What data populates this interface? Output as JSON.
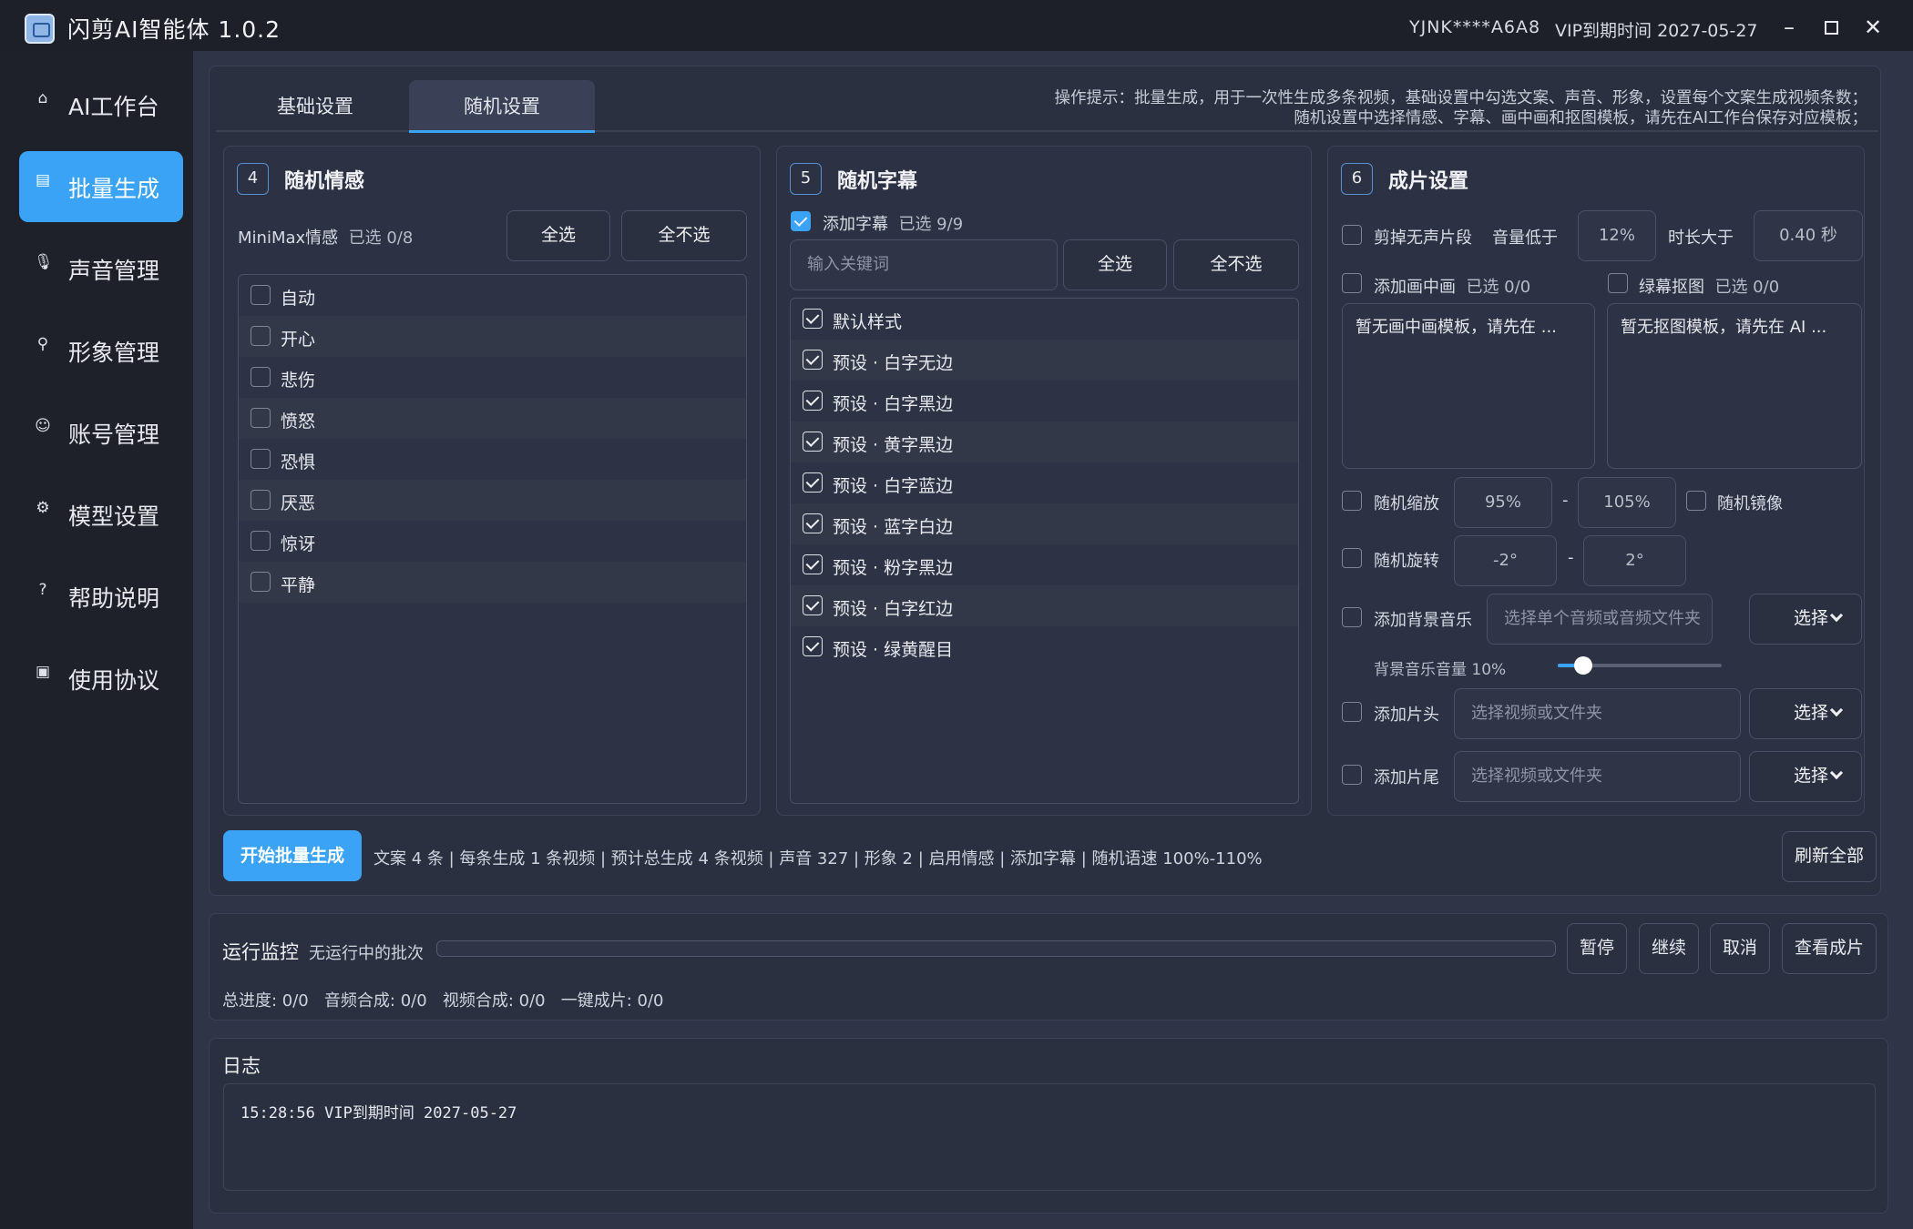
{
  "app": {
    "title": "闪剪AI智能体 1.0.2",
    "user_id": "YJNK****A6A8",
    "vip": "VIP到期时间 2027-05-27"
  },
  "window": {
    "minimize": "–",
    "close": "✕"
  },
  "sidebar": {
    "items": [
      {
        "label": "AI工作台",
        "icon": "home-icon",
        "glyph": "⌂"
      },
      {
        "label": "批量生成",
        "icon": "document-icon",
        "glyph": "▤"
      },
      {
        "label": "声音管理",
        "icon": "microphone-icon",
        "glyph": "🎙"
      },
      {
        "label": "形象管理",
        "icon": "user-icon",
        "glyph": "⚲"
      },
      {
        "label": "账号管理",
        "icon": "account-circle-icon",
        "glyph": "☺"
      },
      {
        "label": "模型设置",
        "icon": "gear-icon",
        "glyph": "⚙"
      },
      {
        "label": "帮助说明",
        "icon": "help-icon",
        "glyph": "?"
      },
      {
        "label": "使用协议",
        "icon": "agreement-icon",
        "glyph": "▣"
      }
    ],
    "active_index": 1
  },
  "tabs": [
    {
      "label": "基础设置"
    },
    {
      "label": "随机设置"
    }
  ],
  "hint": {
    "line1": "操作提示：批量生成，用于一次性生成多条视频，基础设置中勾选文案、声音、形象，设置每个文案生成视频条数；",
    "line2": "随机设置中选择情感、字幕、画中画和抠图模板，请先在AI工作台保存对应模板；"
  },
  "emotion": {
    "num": "4",
    "title": "随机情感",
    "source": "MiniMax情感",
    "selected": "已选 0/8",
    "select_all": "全选",
    "select_none": "全不选",
    "items": [
      "自动",
      "开心",
      "悲伤",
      "愤怒",
      "恐惧",
      "厌恶",
      "惊讶",
      "平静"
    ]
  },
  "subtitle": {
    "num": "5",
    "title": "随机字幕",
    "add_label": "添加字幕",
    "selected": "已选 9/9",
    "search_placeholder": "输入关键词",
    "select_all": "全选",
    "select_none": "全不选",
    "items": [
      "默认样式",
      "预设 · 白字无边",
      "预设 · 白字黑边",
      "预设 · 黄字黑边",
      "预设 · 白字蓝边",
      "预设 · 蓝字白边",
      "预设 · 粉字黑边",
      "预设 · 白字红边",
      "预设 · 绿黄醒目"
    ]
  },
  "output": {
    "num": "6",
    "title": "成片设置",
    "silence": {
      "label": "剪掉无声片段",
      "vol_label": "音量低于",
      "vol_value": "12%",
      "dur_label": "时长大于",
      "dur_value": "0.40 秒"
    },
    "pip": {
      "label": "添加画中画",
      "selected": "已选 0/0",
      "empty": "暂无画中画模板，请先在 ..."
    },
    "matting": {
      "label": "绿幕抠图",
      "selected": "已选 0/0",
      "empty": "暂无抠图模板，请先在 AI ..."
    },
    "zoom": {
      "label": "随机缩放",
      "min": "95%",
      "max": "105%",
      "dash": "-"
    },
    "mirror": {
      "label": "随机镜像"
    },
    "rotate": {
      "label": "随机旋转",
      "min": "-2°",
      "max": "2°",
      "dash": "-"
    },
    "bgm": {
      "label": "添加背景音乐",
      "placeholder": "选择单个音频或音频文件夹",
      "choose": "选择",
      "volume_label": "背景音乐音量 10%",
      "volume": 0.1
    },
    "intro": {
      "label": "添加片头",
      "placeholder": "选择视频或文件夹",
      "choose": "选择"
    },
    "outro": {
      "label": "添加片尾",
      "placeholder": "选择视频或文件夹",
      "choose": "选择"
    }
  },
  "bottom": {
    "start": "开始批量生成",
    "summary": "文案 4 条 | 每条生成 1 条视频 | 预计总生成 4 条视频 | 声音 327 | 形象 2 | 启用情感 | 添加字幕 | 随机语速 100%-110%",
    "refresh": "刷新全部"
  },
  "monitor": {
    "title": "运行监控",
    "status": "无运行中的批次",
    "progress": 0,
    "pause": "暂停",
    "resume": "继续",
    "cancel": "取消",
    "view": "查看成片",
    "stats": "总进度: 0/0   音频合成: 0/0   视频合成: 0/0   一键成片: 0/0"
  },
  "log": {
    "title": "日志",
    "lines": [
      "15:28:56 VIP到期时间 2027-05-27"
    ]
  }
}
